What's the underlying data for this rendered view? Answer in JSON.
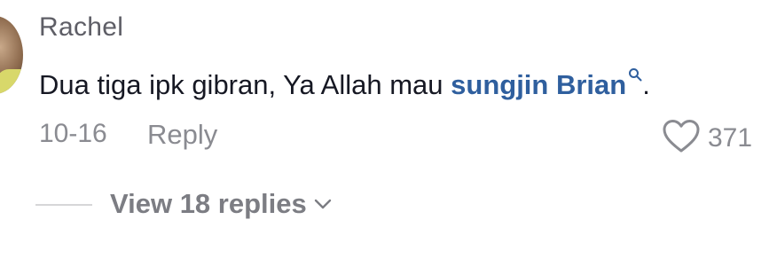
{
  "comment": {
    "username": "Rachel",
    "text_before_mention": "Dua tiga ipk gibran, Ya Allah mau ",
    "mention": "sungjin Brian",
    "text_after_mention": ".",
    "date": "10-16",
    "reply_label": "Reply",
    "like_count": "371",
    "view_replies_label": "View 18 replies"
  },
  "icons": {
    "like": "heart-outline-icon",
    "mention_search": "search-icon",
    "expand": "chevron-down-icon"
  },
  "colors": {
    "mention": "#2f5f9e",
    "muted_text": "#8a8b91",
    "primary_text": "#161823"
  }
}
